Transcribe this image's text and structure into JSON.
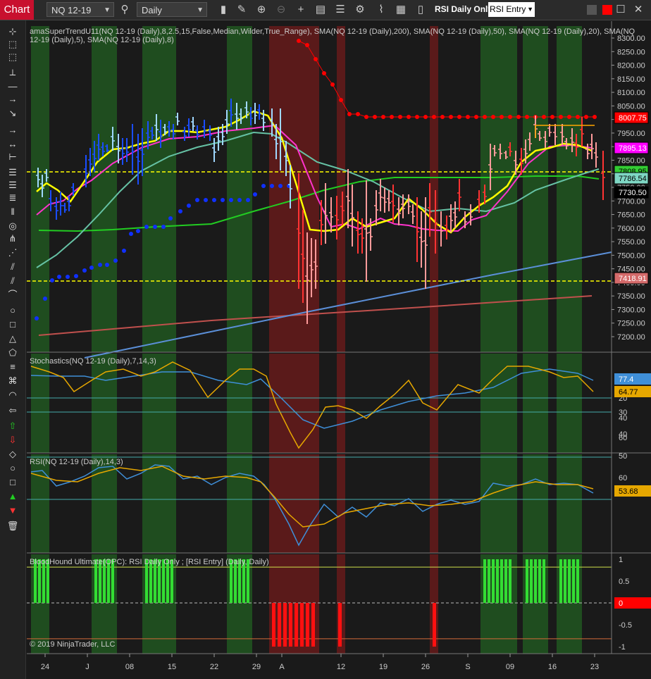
{
  "toolbar": {
    "tab_label": "Chart",
    "instrument": "NQ 12-19",
    "period": "Daily",
    "strategy_label": "RSI Daily Only",
    "strategy_select": "RSI Entry"
  },
  "panels": {
    "price": {
      "label": "amaSuperTrendU11(NQ 12-19 (Daily),8,2.5,15,False,Median,Wilder,True_Range), SMA(NQ 12-19 (Daily),200), SMA(NQ 12-19 (Daily),50), SMA(NQ 12-19 (Daily),20), SMA(NQ 12-19 (Daily),5), SMA(NQ 12-19 (Daily),8)",
      "y_ticks": [
        "8300.00",
        "8250.00",
        "8200.00",
        "8150.00",
        "8100.00",
        "8050.00",
        "8000.00",
        "7950.00",
        "7900.00",
        "7850.00",
        "7800.00",
        "7750.00",
        "7700.00",
        "7650.00",
        "7600.00",
        "7550.00",
        "7500.00",
        "7450.00",
        "7400.00",
        "7350.00",
        "7300.00",
        "7250.00",
        "7200.00"
      ],
      "flags": [
        {
          "text": "8007.75",
          "bg": "#ff0000",
          "fg": "#ffffff"
        },
        {
          "text": "7895.13",
          "bg": "#ff00ff",
          "fg": "#ffffff"
        },
        {
          "text": "7808.95",
          "bg": "#33cc33",
          "fg": "#000000"
        },
        {
          "text": "7786.54",
          "bg": "#7fd7c4",
          "fg": "#000000"
        },
        {
          "text": "7730.50",
          "bg": "#000000",
          "fg": "#ffffff"
        },
        {
          "text": "7418.91",
          "bg": "#d46a6a",
          "fg": "#ffffff"
        }
      ]
    },
    "stochastics": {
      "label": "Stochastics(NQ 12-19 (Daily),7,14,3)",
      "y_ticks": [
        "60",
        "40",
        "20"
      ],
      "flags": [
        {
          "text": "77.4",
          "bg": "#3f8fd8",
          "fg": "#ffffff"
        },
        {
          "text": "64.77",
          "bg": "#e6a700",
          "fg": "#000000"
        }
      ]
    },
    "rsi": {
      "label": "RSI(NQ 12-19 (Daily),14,3)",
      "y_ticks": [
        "60",
        "50",
        "40",
        "30"
      ],
      "flags": [
        {
          "text": "53.68",
          "bg": "#e6a700",
          "fg": "#000000"
        }
      ]
    },
    "bloodhound": {
      "label": "BloodHound Ultimate(OPC): RSI Daily Only ; [RSI Entry] (Daily, Daily)",
      "y_ticks": [
        "1",
        "0.5",
        "0",
        "-0.5",
        "-1"
      ],
      "flags": [
        {
          "text": "0",
          "bg": "#ff0000",
          "fg": "#ffffff"
        }
      ],
      "copyright": "© 2019 NinjaTrader, LLC"
    }
  },
  "x_axis": [
    "24",
    "J",
    "08",
    "15",
    "22",
    "29",
    "A",
    "12",
    "19",
    "26",
    "S",
    "09",
    "16",
    "23"
  ],
  "colors": {
    "bg": "#1a1a1a",
    "green_zone": "#1f4d1f",
    "red_zone": "#5a1a1a",
    "sma200": "#c0504d",
    "sma50": "#22cc22",
    "sma20": "#66c2a5",
    "sma5": "#ffff00",
    "sma8": "#ff33cc",
    "trend": "#5b8fd8"
  }
}
